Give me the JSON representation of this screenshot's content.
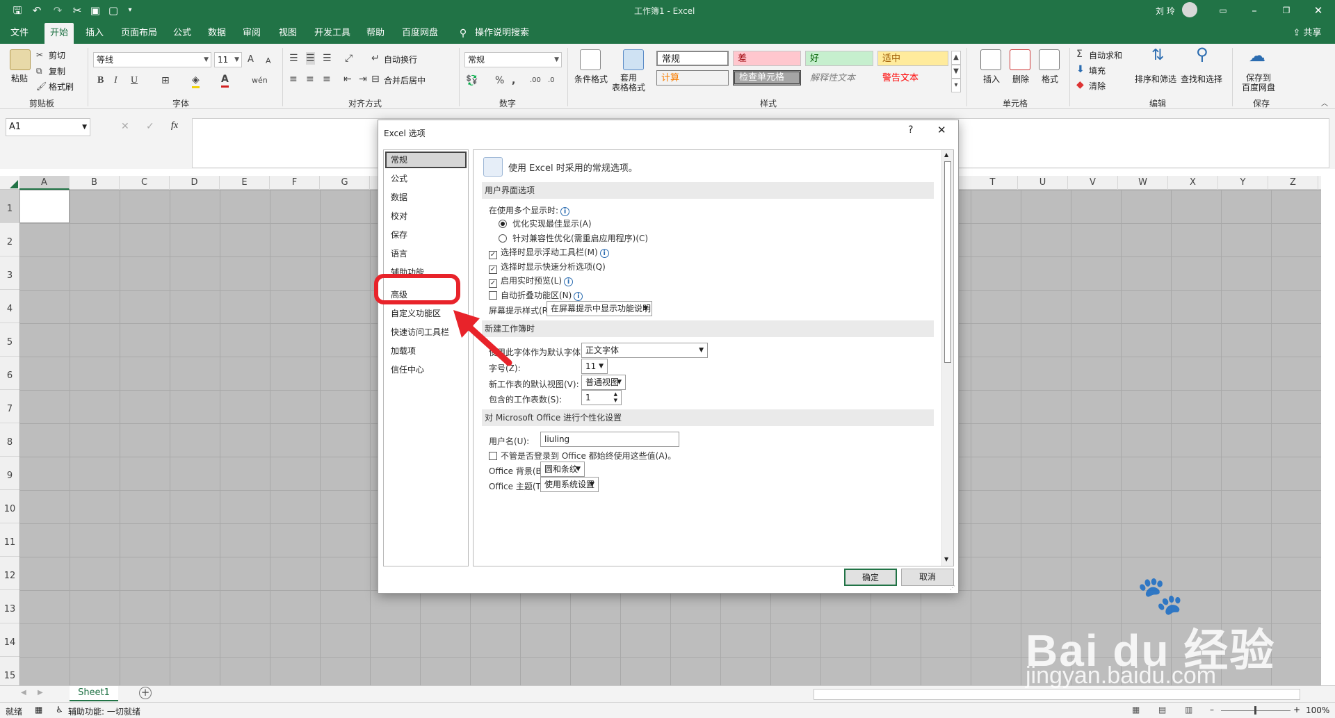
{
  "app": {
    "title": "工作簿1 - Excel",
    "user": "刘 玲",
    "share": "共享"
  },
  "tabs": [
    "文件",
    "开始",
    "插入",
    "页面布局",
    "公式",
    "数据",
    "审阅",
    "视图",
    "开发工具",
    "帮助",
    "百度网盘",
    "操作说明搜索"
  ],
  "ribbon": {
    "clipboard": {
      "paste": "粘贴",
      "cut": "剪切",
      "copy": "复制",
      "format_painter": "格式刷",
      "label": "剪贴板"
    },
    "font": {
      "name": "等线",
      "size": "11",
      "label": "字体",
      "bold": "B",
      "italic": "I",
      "underline": "U",
      "grow": "A",
      "shrink": "A",
      "color_a": "A",
      "pinyin": "wén"
    },
    "alignment": {
      "wrap": "自动换行",
      "merge": "合并后居中",
      "label": "对齐方式"
    },
    "number": {
      "format": "常规",
      "label": "数字",
      "percent": "%",
      "comma": ","
    },
    "styles": {
      "cond": "条件格式",
      "table": "套用\n表格格式",
      "label": "样式",
      "cells": [
        "常规",
        "差",
        "好",
        "适中",
        "计算",
        "检查单元格",
        "解释性文本",
        "警告文本"
      ]
    },
    "cells_group": {
      "insert": "插入",
      "delete": "删除",
      "format": "格式",
      "label": "单元格"
    },
    "editing": {
      "autosum": "自动求和",
      "fill": "填充",
      "clear": "清除",
      "sort": "排序和筛选",
      "find": "查找和选择",
      "label": "编辑"
    },
    "save": {
      "btn": "保存到\n百度网盘",
      "label": "保存"
    }
  },
  "formula": {
    "namebox": "A1",
    "fx": "fx"
  },
  "columns": [
    "A",
    "B",
    "C",
    "D",
    "E",
    "F",
    "G",
    "T",
    "U",
    "V",
    "W",
    "X",
    "Y",
    "Z"
  ],
  "rows": [
    "1",
    "2",
    "3",
    "4",
    "5",
    "6",
    "7",
    "8",
    "9",
    "10",
    "11",
    "12",
    "13",
    "14",
    "15"
  ],
  "dialog": {
    "title": "Excel 选项",
    "help": "?",
    "close": "✕",
    "nav": [
      "常规",
      "公式",
      "数据",
      "校对",
      "保存",
      "语言",
      "辅助功能",
      "高级",
      "自定义功能区",
      "快速访问工具栏",
      "加载项",
      "信任中心"
    ],
    "intro": "使用 Excel 时采用的常规选项。",
    "sec_ui": "用户界面选项",
    "multi_display": "在使用多个显示时:",
    "radio1": "优化实现最佳显示(A)",
    "radio2": "针对兼容性优化(需重启应用程序)(C)",
    "cb1": "选择时显示浮动工具栏(M)",
    "cb2": "选择时显示快速分析选项(Q)",
    "cb3": "启用实时预览(L)",
    "cb4": "自动折叠功能区(N)",
    "tip_label": "屏幕提示样式(R):",
    "tip_value": "在屏幕提示中显示功能说明",
    "sec_new": "新建工作簿时",
    "font_label": "使用此字体作为默认字体(N):",
    "font_value": "正文字体",
    "size_label": "字号(Z):",
    "size_value": "11",
    "view_label": "新工作表的默认视图(V):",
    "view_value": "普通视图",
    "count_label": "包含的工作表数(S):",
    "count_value": "1",
    "sec_personal": "对 Microsoft Office 进行个性化设置",
    "user_label": "用户名(U):",
    "user_value": "liuling",
    "always_cb": "不管是否登录到 Office 都始终使用这些值(A)。",
    "bg_label": "Office 背景(B):",
    "bg_value": "圆和条纹",
    "theme_label": "Office 主题(T):",
    "theme_value": "使用系统设置",
    "ok": "确定",
    "cancel": "取消"
  },
  "sheet": {
    "tab": "Sheet1"
  },
  "status": {
    "ready": "就绪",
    "accessibility": "辅助功能: 一切就绪",
    "zoom": "100%"
  },
  "watermark": {
    "brand": "Bai du 经验",
    "url": "jingyan.baidu.com"
  },
  "colors": {
    "excel_green": "#217346",
    "highlight": "#e8232a"
  }
}
